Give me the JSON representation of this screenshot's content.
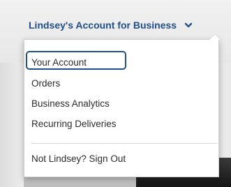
{
  "account": {
    "title": "Lindsey's Account for Business",
    "chevron_icon": "chevron-down-icon"
  },
  "menu": {
    "items": [
      {
        "label": "Your Account",
        "highlighted": true
      },
      {
        "label": "Orders"
      },
      {
        "label": "Business Analytics"
      },
      {
        "label": "Recurring Deliveries"
      }
    ],
    "sign_out": "Not Lindsey? Sign Out"
  },
  "colors": {
    "title_blue": "#1f4f86",
    "menu_text": "#2b2b2b",
    "highlight_border": "#1f4f86"
  }
}
